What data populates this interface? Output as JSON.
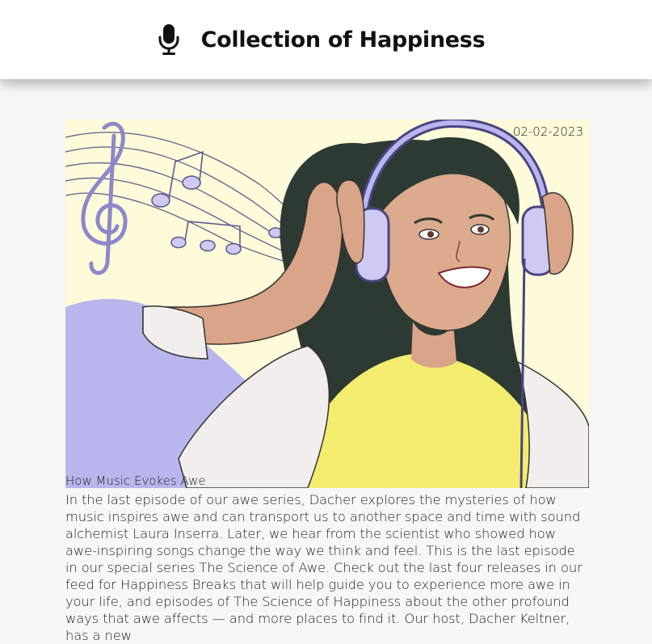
{
  "header": {
    "icon": "microphone-icon",
    "title": "Collection of Happiness"
  },
  "episode": {
    "date": "02-02-2023",
    "title": "How Music Evokes Awe",
    "image_alt": "Illustration of a woman with long dark hair wearing purple headphones, smiling, with music notes",
    "description": "In the last episode of our awe series, Dacher explores the mysteries of how music inspires awe and can transport us to another space and time with sound alchemist Laura Inserra. Later, we hear from the scientist who showed how awe-inspiring songs change the way we think and feel. This is the last episode in our special series The Science of Awe. Check out the last four releases in our feed for Happiness Breaks that will help guide you to experience more awe in your life, and episodes of The Science of Happiness about the other profound ways that awe affects — and more places to find it. Our host, Dacher Keltner, has a new"
  },
  "colors": {
    "header_bg": "#ffffff",
    "page_bg": "#f7f7f7",
    "art_bg": "#fdfbd9",
    "art_purple": "#b9b6ee",
    "hair": "#2c3a33",
    "shirt": "#f3ec6e",
    "skin": "#d9a487"
  }
}
